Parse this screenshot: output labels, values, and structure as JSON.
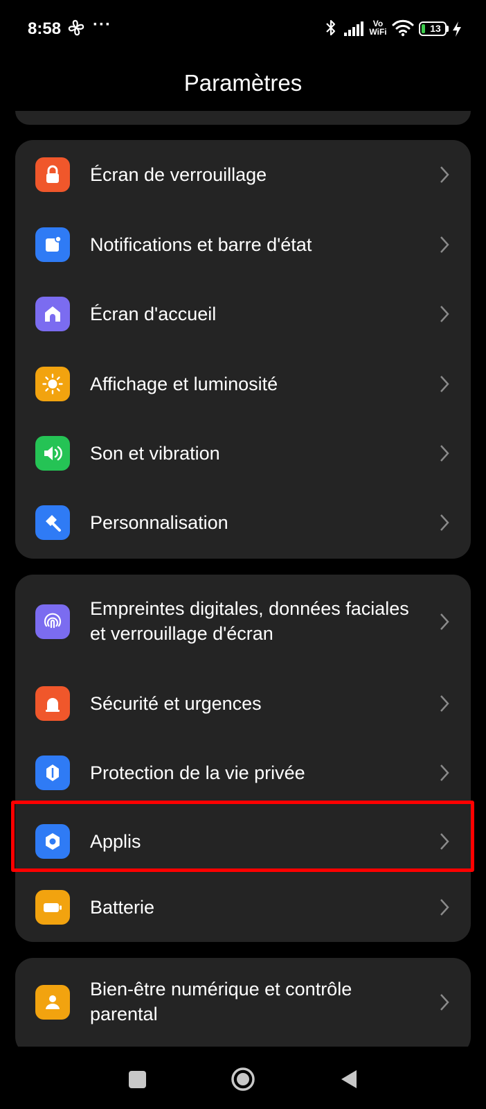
{
  "status_bar": {
    "time": "8:58",
    "more": "···",
    "vowifi_top": "Vo",
    "vowifi_bottom": "WiFi",
    "battery_level": "13",
    "icons": [
      "fan-icon",
      "bluetooth-icon",
      "cell-signal-icon",
      "vowifi-icon",
      "wifi-icon",
      "battery-icon",
      "charging-bolt-icon"
    ]
  },
  "header": {
    "title": "Paramètres"
  },
  "groups": [
    {
      "items": [
        {
          "label": "Écran de verrouillage",
          "icon": "lock-icon",
          "color": "#f0572b"
        },
        {
          "label": "Notifications et barre d'état",
          "icon": "notification-icon",
          "color": "#2f7bf5"
        },
        {
          "label": "Écran d'accueil",
          "icon": "home-icon",
          "color": "#7b6cf0"
        },
        {
          "label": "Affichage et luminosité",
          "icon": "sun-icon",
          "color": "#f2a30f"
        },
        {
          "label": "Son et vibration",
          "icon": "speaker-icon",
          "color": "#25c355"
        },
        {
          "label": "Personnalisation",
          "icon": "brush-icon",
          "color": "#2f7bf5"
        }
      ]
    },
    {
      "items": [
        {
          "label": "Empreintes digitales, données faciales et verrouillage d'écran",
          "icon": "fingerprint-icon",
          "color": "#7b6cf0"
        },
        {
          "label": "Sécurité et urgences",
          "icon": "alarm-icon",
          "color": "#f0572b"
        },
        {
          "label": "Protection de la vie privée",
          "icon": "privacy-shield-icon",
          "color": "#2f7bf5"
        },
        {
          "label": "Applis",
          "icon": "apps-hexagon-icon",
          "color": "#2f7bf5",
          "highlighted": true
        },
        {
          "label": "Batterie",
          "icon": "battery-setting-icon",
          "color": "#f2a30f"
        }
      ]
    },
    {
      "items": [
        {
          "label": "Bien-être numérique et contrôle parental",
          "icon": "wellbeing-icon",
          "color": "#f2a30f"
        }
      ]
    }
  ],
  "nav_bar": {
    "icons": [
      "recents-square-icon",
      "home-circle-icon",
      "back-triangle-icon"
    ]
  },
  "colors": {
    "background": "#000000",
    "card": "#242424",
    "highlight": "#ff0000",
    "text": "#ffffff",
    "chevron": "#8a8a8a"
  }
}
